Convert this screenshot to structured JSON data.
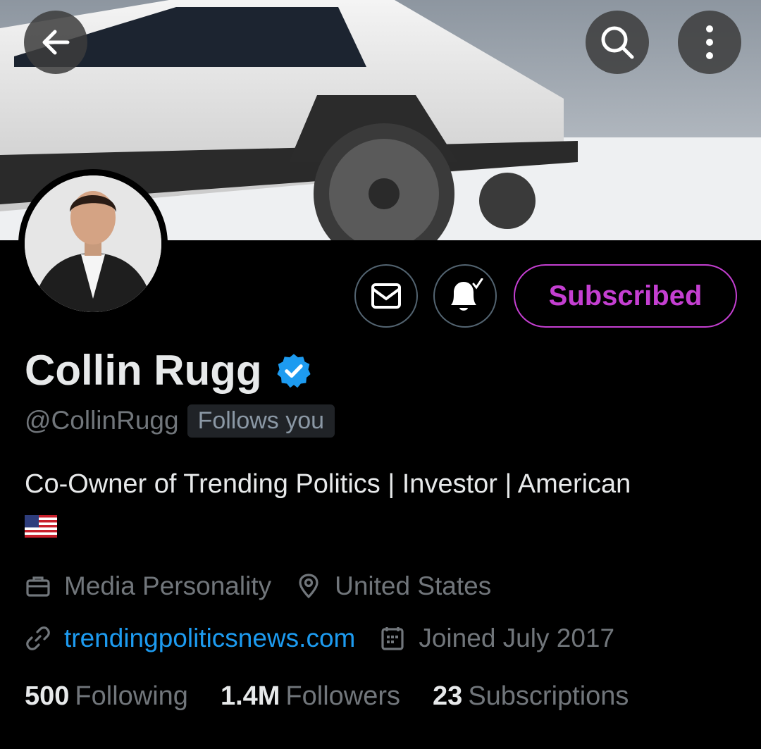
{
  "profile": {
    "name": "Collin Rugg",
    "handle": "@CollinRugg",
    "follows_you": "Follows you",
    "bio": "Co-Owner of Trending Politics | Investor | American",
    "category": "Media Personality",
    "location": "United States",
    "website": "trendingpoliticsnews.com",
    "joined": "Joined July 2017"
  },
  "actions": {
    "subscribed_label": "Subscribed"
  },
  "stats": {
    "following_count": "500",
    "following_label": "Following",
    "followers_count": "1.4M",
    "followers_label": "Followers",
    "subscriptions_count": "23",
    "subscriptions_label": "Subscriptions"
  },
  "icons": {
    "back": "arrow-left-icon",
    "search": "search-icon",
    "more": "more-vertical-icon",
    "message": "mail-icon",
    "notifications": "bell-check-icon",
    "verified": "verified-badge-icon",
    "category": "briefcase-icon",
    "location": "location-pin-icon",
    "website": "link-icon",
    "joined": "calendar-icon",
    "flag": "us-flag-icon"
  },
  "colors": {
    "background": "#000000",
    "text_primary": "#e7e9ea",
    "text_secondary": "#71767b",
    "link": "#1d9bf0",
    "subscribed_accent": "#c43fd1",
    "verified": "#1d9bf0"
  }
}
